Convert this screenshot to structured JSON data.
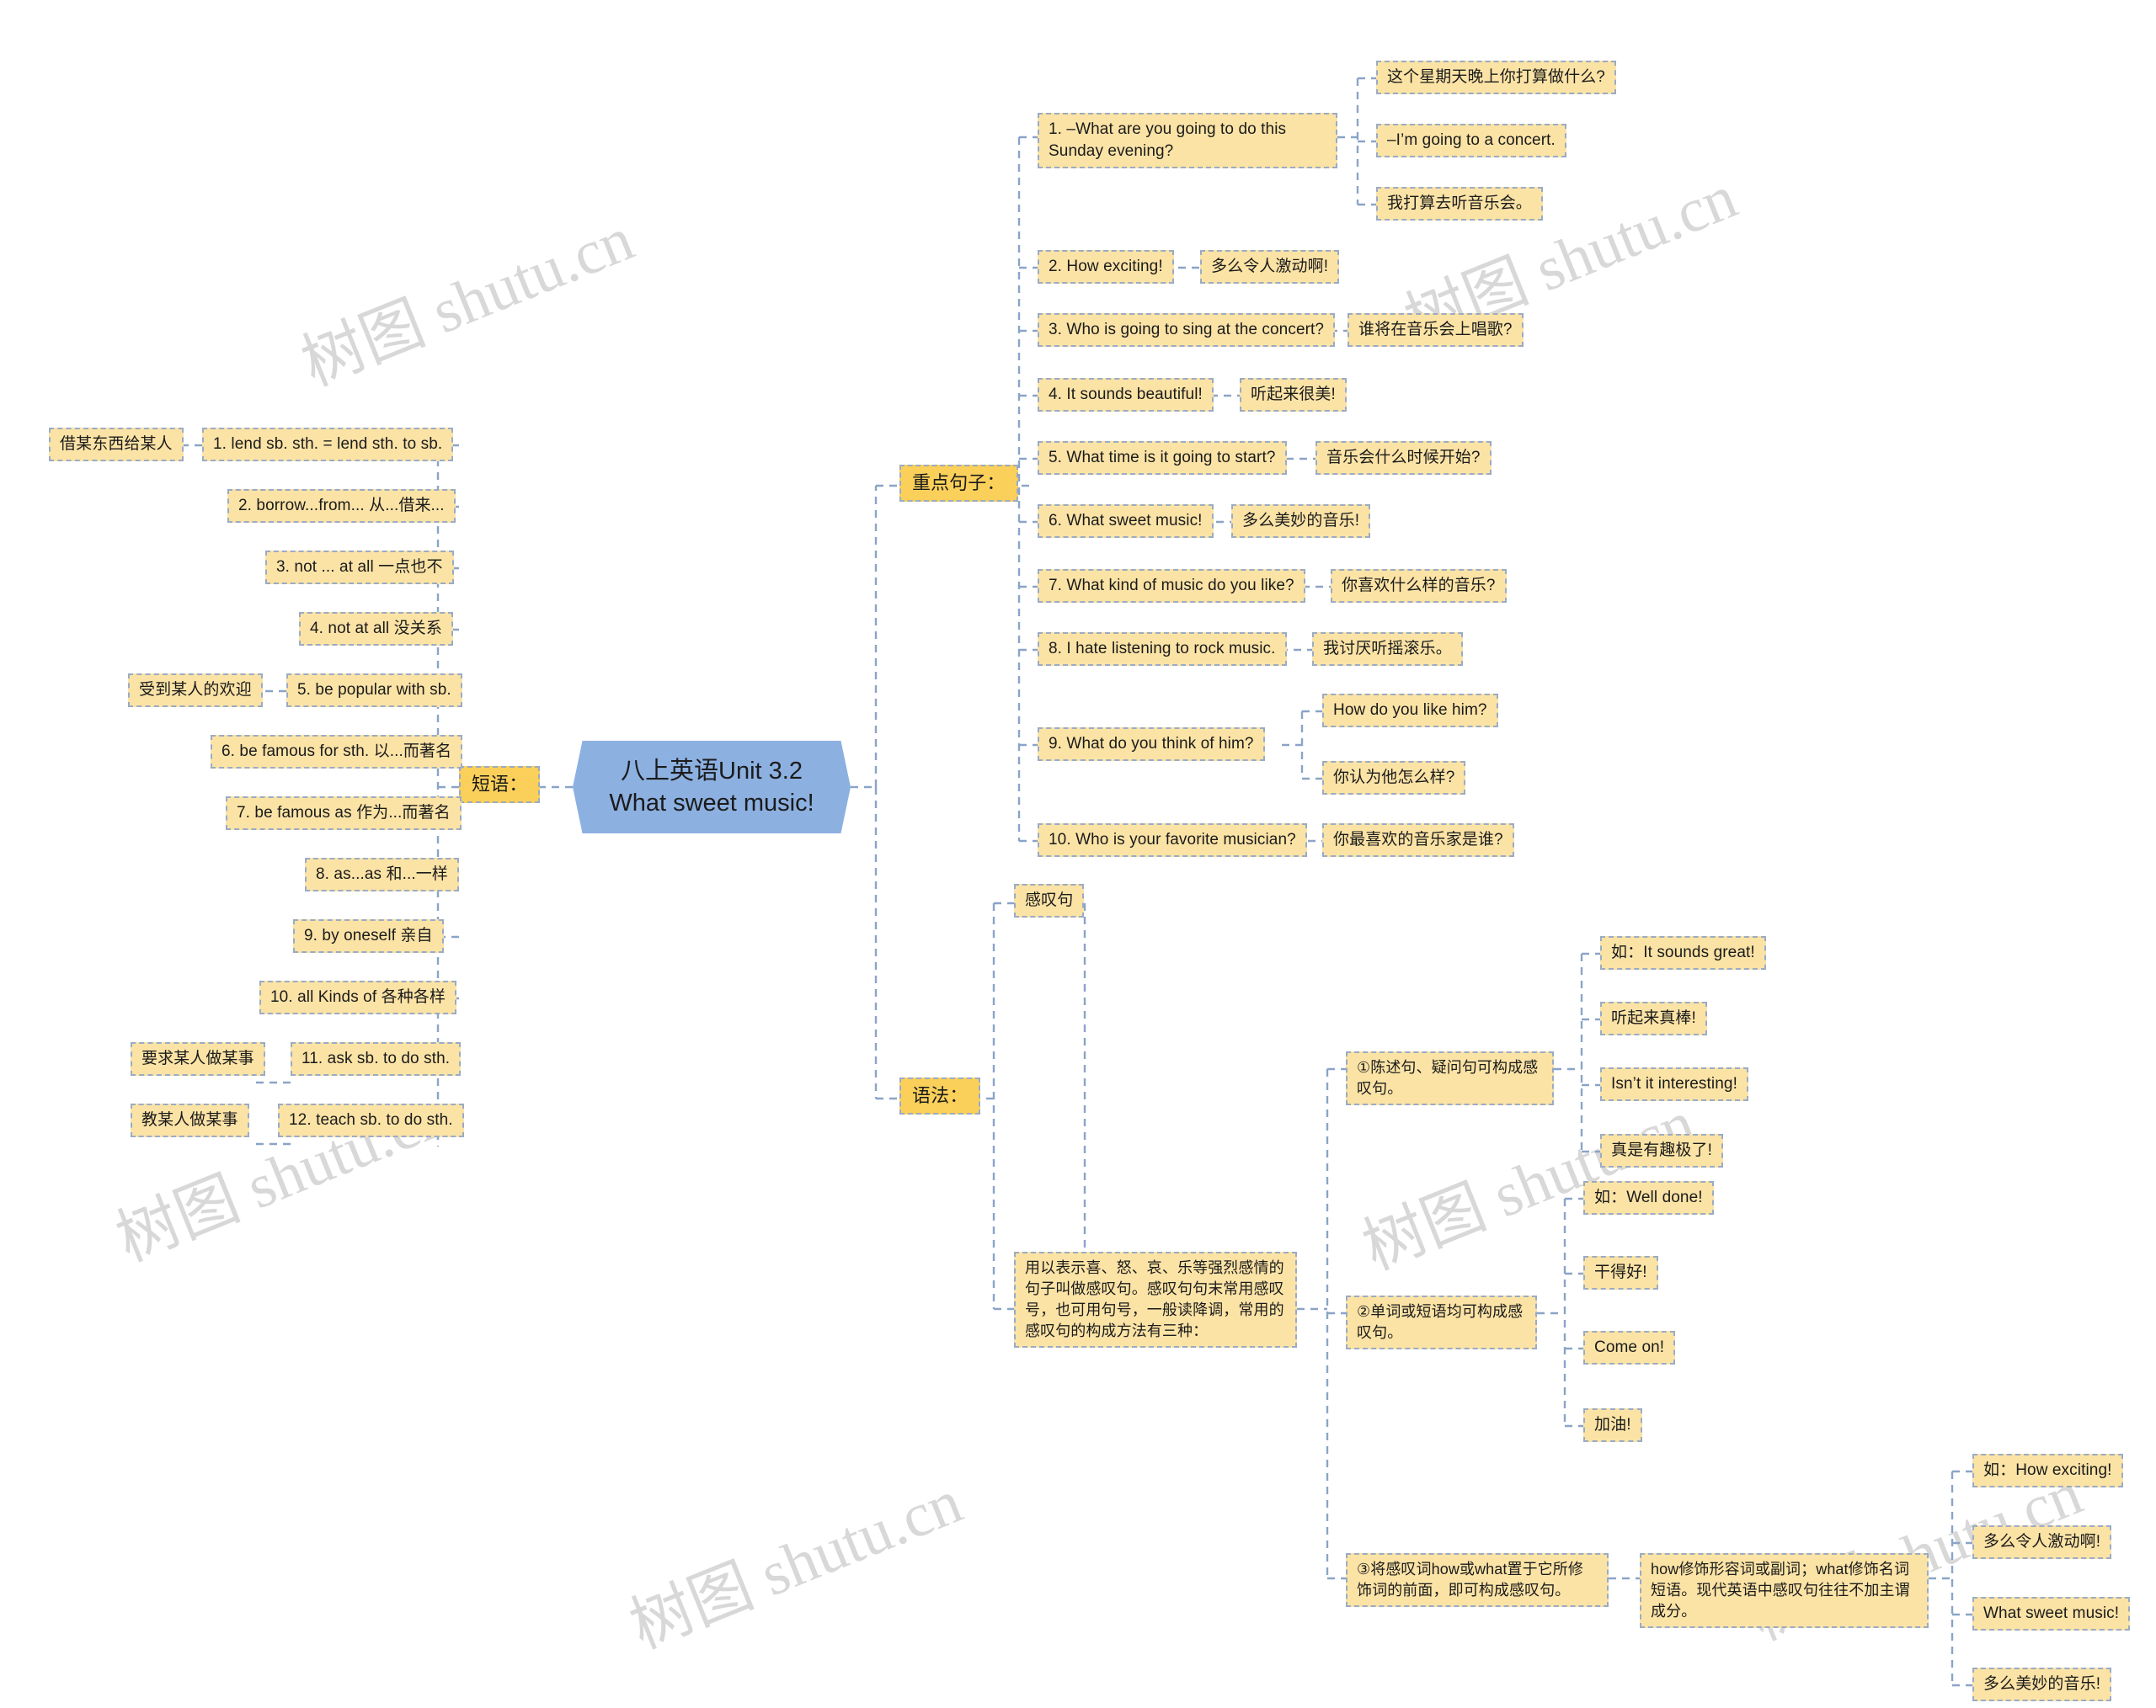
{
  "root": {
    "label": "八上英语Unit 3.2 What sweet music!"
  },
  "watermarks": [
    "树图 shutu.cn",
    "树图 shutu.cn",
    "树图 shutu.cn",
    "树图 shutu.cn",
    "树图 shutu.cn",
    "树图 shutu.cn"
  ],
  "branches": {
    "phrases": {
      "label": "短语："
    },
    "key_sentences": {
      "label": "重点句子："
    },
    "grammar": {
      "label": "语法："
    }
  },
  "phrases": {
    "items": [
      {
        "en": "1. lend sb. sth. = lend sth. to sb.",
        "cn": "借某东西给某人"
      },
      {
        "en": "2. borrow...from...  从...借来...",
        "cn": ""
      },
      {
        "en": "3. not ... at all  一点也不",
        "cn": ""
      },
      {
        "en": "4. not at all 没关系",
        "cn": ""
      },
      {
        "en": "5. be popular with sb.",
        "cn": "受到某人的欢迎"
      },
      {
        "en": "6. be famous for sth. 以...而著名",
        "cn": ""
      },
      {
        "en": "7. be famous as 作为...而著名",
        "cn": ""
      },
      {
        "en": "8. as...as 和...一样",
        "cn": ""
      },
      {
        "en": "9. by oneself  亲自",
        "cn": ""
      },
      {
        "en": "10. all Kinds of 各种各样",
        "cn": ""
      },
      {
        "en": "11. ask sb. to do sth.",
        "cn": "要求某人做某事"
      },
      {
        "en": "12. teach sb. to do sth.",
        "cn": "教某人做某事"
      }
    ]
  },
  "key_sentences": {
    "items": [
      {
        "en": "1. –What are you going to do this Sunday evening?",
        "children": [
          "这个星期天晚上你打算做什么?",
          "–I’m going to a concert.",
          "我打算去听音乐会。"
        ]
      },
      {
        "en": "2. How exciting!",
        "children": [
          "多么令人激动啊!"
        ]
      },
      {
        "en": "3. Who is going to sing at the concert?",
        "children": [
          "谁将在音乐会上唱歌?"
        ]
      },
      {
        "en": "4. It sounds beautiful!",
        "children": [
          "听起来很美!"
        ]
      },
      {
        "en": "5. What time is it going to start?",
        "children": [
          "音乐会什么时候开始?"
        ]
      },
      {
        "en": "6. What sweet music!",
        "children": [
          "多么美妙的音乐!"
        ]
      },
      {
        "en": "7. What kind of music do you like?",
        "children": [
          "你喜欢什么样的音乐?"
        ]
      },
      {
        "en": "8. I hate listening to rock music.",
        "children": [
          "我讨厌听摇滚乐。"
        ]
      },
      {
        "en": "9. What do you think of him?",
        "children": [
          "How do you like him?",
          "你认为他怎么样?"
        ]
      },
      {
        "en": "10. Who is your favorite musician?",
        "children": [
          "你最喜欢的音乐家是谁?"
        ]
      }
    ]
  },
  "grammar": {
    "topic": "感叹句",
    "definition": "用以表示喜、怒、哀、乐等强烈感情的句子叫做感叹句。感叹句句末常用感叹号，也可用句号，一般读降调，常用的感叹句的构成方法有三种：",
    "rules": [
      {
        "text": "①陈述句、疑问句可构成感叹句。",
        "examples": [
          "如：It sounds great!",
          "听起来真棒!",
          "Isn’t it interesting!",
          "真是有趣极了!"
        ]
      },
      {
        "text": "②单词或短语均可构成感叹句。",
        "examples": [
          "如：Well done!",
          "干得好!",
          "Come on!",
          "加油!"
        ]
      },
      {
        "text": "③将感叹词how或what置于它所修饰词的前面，即可构成感叹句。",
        "note": "how修饰形容词或副词；what修饰名词短语。现代英语中感叹句往往不加主谓成分。",
        "examples": [
          "如：How exciting!",
          "多么令人激动啊!",
          "What sweet music!",
          "多么美妙的音乐!"
        ]
      }
    ]
  },
  "colors": {
    "leaf_fill": "#fbe3a6",
    "branch_fill": "#fbd05a",
    "root_fill": "#8cb0e0",
    "wire": "#8aa4c8",
    "border": "#9aabc4"
  }
}
